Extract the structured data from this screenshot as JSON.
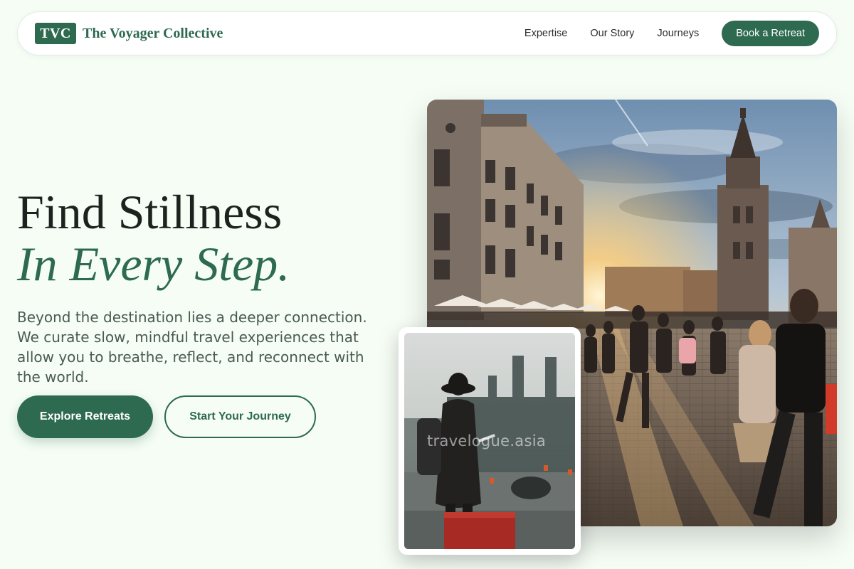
{
  "header": {
    "logo_mark": "TVC",
    "brand_name": "The Voyager Collective",
    "nav": [
      {
        "label": "Expertise"
      },
      {
        "label": "Our Story"
      },
      {
        "label": "Journeys"
      }
    ],
    "cta_label": "Book a Retreat"
  },
  "hero": {
    "headline_line1": "Find Stillness",
    "headline_line2": "In Every Step.",
    "description": "Beyond the destination lies a deeper connection. We curate slow, mindful travel experiences that allow you to breathe, reflect, and reconnect with the world.",
    "primary_button": "Explore Retreats",
    "secondary_button": "Start Your Journey"
  },
  "images": {
    "main": {
      "icon": "city-square-photo"
    },
    "inset": {
      "icon": "traveler-silhouette-photo",
      "watermark": "travelogue.asia"
    }
  },
  "colors": {
    "accent": "#2e6a50",
    "background": "#f5fdf5",
    "text": "#1c221e",
    "muted_text": "#4a5a52"
  }
}
